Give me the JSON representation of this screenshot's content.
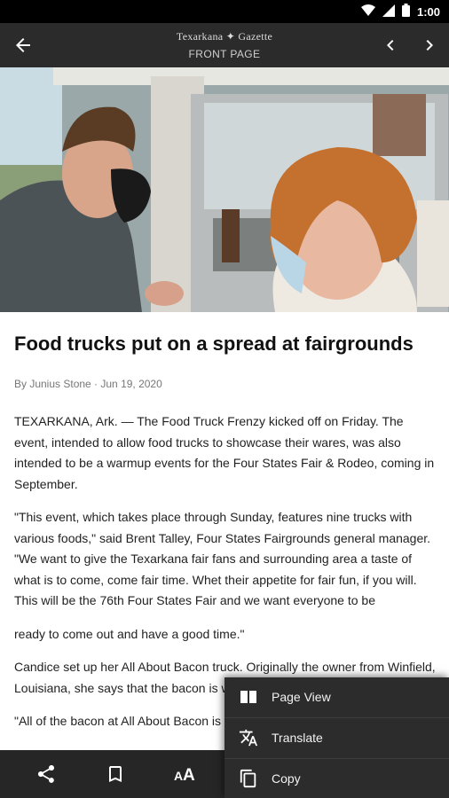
{
  "status_bar": {
    "time": "1:00"
  },
  "app_bar": {
    "masthead": "Texarkana ✦ Gazette",
    "section": "FRONT PAGE"
  },
  "article": {
    "headline": "Food trucks put on a spread at fairgrounds",
    "byline": "By Junius Stone · Jun 19, 2020",
    "paragraphs": [
      "TEXARKANA, Ark. — The Food Truck Frenzy kicked off on Friday. The event, intended to allow food trucks to showcase their wares, was also intended to be a warmup events for the Four States Fair & Rodeo, coming in September.",
      "\"This event, which takes place through Sunday, features nine trucks with various foods,\" said Brent Talley, Four States Fairgrounds general manager. \"We want to give the Texarkana fair fans and surrounding area a taste of what is to come, come fair time. Whet their appetite for fair fun, if you will. This will be the 76th Four States Fair and we want everyone to be",
      "ready to come out and have a good time.\"",
      "Candice set up her All About Bacon truck. Originally the owner from Winfield, Louisiana, she says that the bacon is what she really does.",
      "\"All of the bacon at All About Bacon is"
    ]
  },
  "menu": {
    "items": [
      {
        "label": "Page View",
        "icon": "page-view-icon"
      },
      {
        "label": "Translate",
        "icon": "translate-icon"
      },
      {
        "label": "Copy",
        "icon": "copy-icon"
      }
    ]
  },
  "bottom_bar": {
    "icons": [
      "share-icon",
      "bookmark-icon",
      "text-size-icon"
    ]
  }
}
